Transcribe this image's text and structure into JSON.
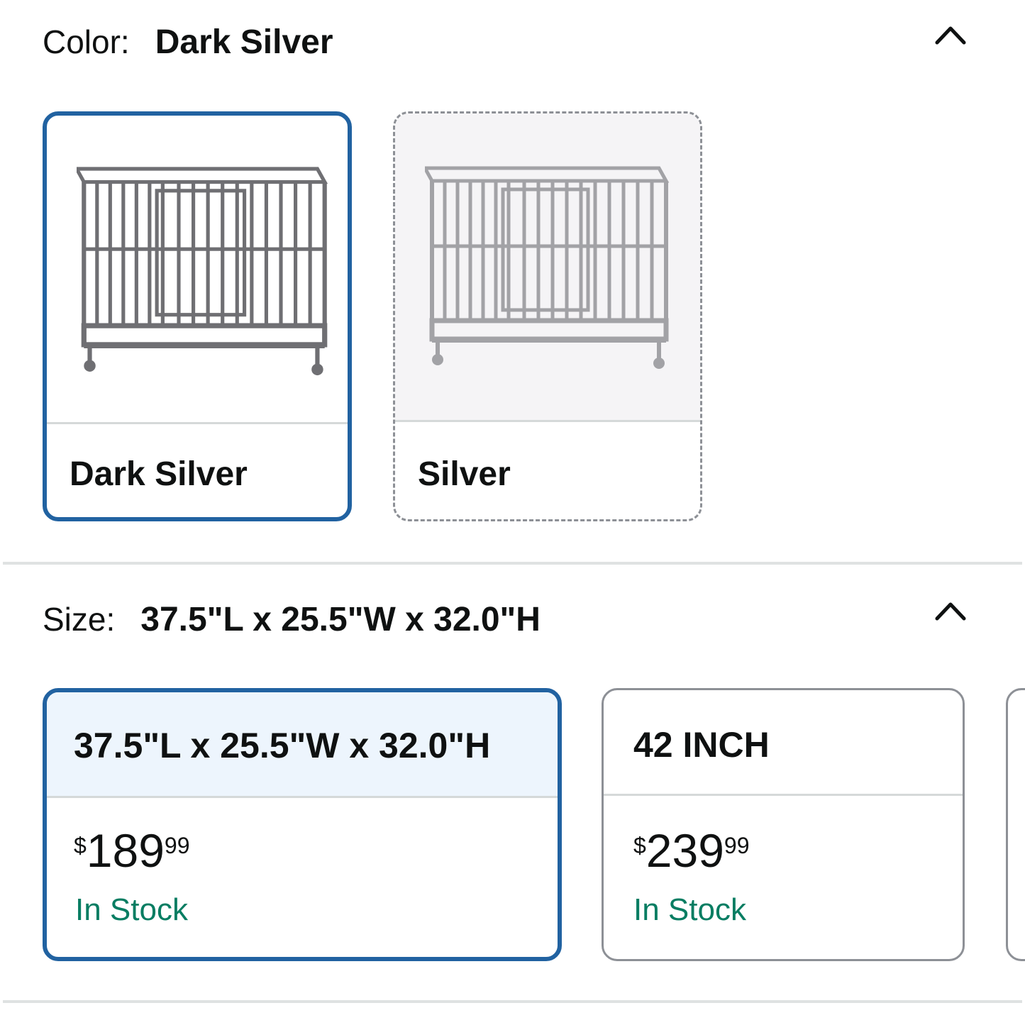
{
  "color": {
    "label": "Color:",
    "selected_value": "Dark Silver",
    "options": [
      {
        "name": "Dark Silver",
        "image": "dog-crate-dark-silver",
        "selected": true
      },
      {
        "name": "Silver",
        "image": "dog-crate-silver",
        "selected": false
      }
    ]
  },
  "size": {
    "label": "Size:",
    "selected_value": "37.5\"L x 25.5\"W x 32.0\"H",
    "options": [
      {
        "name": "37.5\"L x 25.5\"W x 32.0\"H",
        "price_symbol": "$",
        "price_whole": "189",
        "price_fraction": "99",
        "availability": "In Stock",
        "selected": true
      },
      {
        "name": "42 INCH",
        "price_symbol": "$",
        "price_whole": "239",
        "price_fraction": "99",
        "availability": "In Stock",
        "selected": false
      }
    ]
  },
  "icons": {
    "collapse": "chevron-up-icon"
  },
  "colors": {
    "selected_border": "#2162a1",
    "selected_fill": "#edf5fd",
    "in_stock": "#067d62",
    "unselected_border": "#8d9096"
  }
}
